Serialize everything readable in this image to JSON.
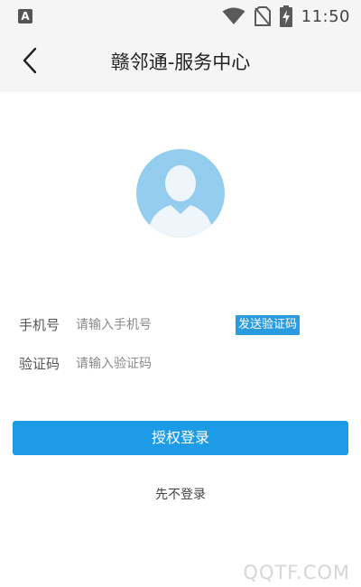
{
  "status_bar": {
    "app_icon_letter": "A",
    "time": "11:50",
    "icons": [
      "app-notification-icon",
      "wifi-icon",
      "no-sim-icon",
      "battery-charging-icon"
    ]
  },
  "header": {
    "back_icon": "chevron-left-icon",
    "title": "赣邻通-服务中心"
  },
  "avatar": {
    "icon": "default-user-avatar",
    "color": "#95cdee"
  },
  "form": {
    "phone": {
      "label": "手机号",
      "placeholder": "请输入手机号",
      "value": ""
    },
    "send_code_label": "发送验证码",
    "code": {
      "label": "验证码",
      "placeholder": "请输入验证码",
      "value": ""
    }
  },
  "actions": {
    "login_label": "授权登录",
    "skip_label": "先不登录"
  },
  "watermark": "QQTF.COM",
  "colors": {
    "accent": "#1d9be6",
    "header_bg": "#f5f5f5"
  }
}
